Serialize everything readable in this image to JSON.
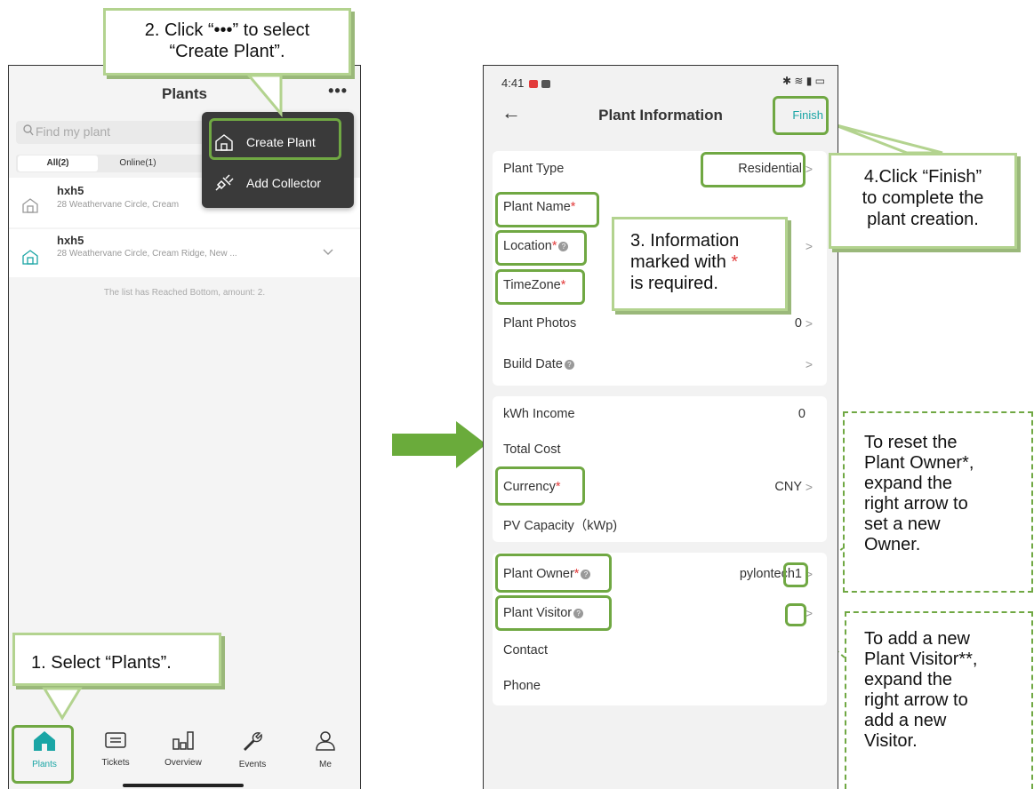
{
  "left_phone": {
    "title": "Plants",
    "more": "•••",
    "search_placeholder": "Find my plant",
    "tabs": [
      "All(2)",
      "Online(1)"
    ],
    "plants": [
      {
        "name": "hxh5",
        "address": "28 Weathervane Circle, Cream"
      },
      {
        "name": "hxh5",
        "address": "28 Weathervane Circle, Cream Ridge, New ..."
      }
    ],
    "list_end": "The list has Reached Bottom, amount: 2.",
    "menu": [
      {
        "label": "Create Plant",
        "icon": "house-icon"
      },
      {
        "label": "Add Collector",
        "icon": "plug-icon"
      }
    ],
    "nav": [
      {
        "label": "Plants",
        "icon": "home-icon"
      },
      {
        "label": "Tickets",
        "icon": "ticket-icon"
      },
      {
        "label": "Overview",
        "icon": "bars-icon"
      },
      {
        "label": "Events",
        "icon": "wrench-icon"
      },
      {
        "label": "Me",
        "icon": "person-icon"
      }
    ]
  },
  "right_phone": {
    "time": "4:41",
    "status_icons": "✱ ≋ ▮ ▭",
    "back": "←",
    "title": "Plant Information",
    "finish": "Finish",
    "fields": {
      "plant_type": {
        "label": "Plant Type",
        "value": "Residential"
      },
      "plant_name": {
        "label": "Plant Name",
        "req": "*"
      },
      "location": {
        "label": "Location",
        "req": "*"
      },
      "timezone": {
        "label": "TimeZone",
        "req": "*"
      },
      "plant_photos": {
        "label": "Plant Photos",
        "value": "0"
      },
      "build_date": {
        "label": "Build Date"
      },
      "kwh_income": {
        "label": "kWh Income",
        "value": "0"
      },
      "total_cost": {
        "label": "Total Cost"
      },
      "currency": {
        "label": "Currency",
        "req": "*",
        "value": "CNY"
      },
      "pv_capacity": {
        "label": "PV Capacity（kWp)"
      },
      "plant_owner": {
        "label": "Plant Owner",
        "req": "*",
        "value": "pylontech1"
      },
      "plant_visitor": {
        "label": "Plant Visitor"
      },
      "contact": {
        "label": "Contact"
      },
      "phone": {
        "label": "Phone"
      }
    }
  },
  "annotations": {
    "step1": "1. Select “Plants”.",
    "step2_line1": "2. Click “•••” to select",
    "step2_line2": "“Create Plant”.",
    "step3_line1": "3. Information",
    "step3_line2": "marked with",
    "step3_star": "*",
    "step3_line3": "is required.",
    "step4_line1": "4.Click “Finish”",
    "step4_line2": "to complete the",
    "step4_line3": "plant creation.",
    "owner_note": [
      "To reset the",
      "Plant Owner*,",
      "expand the",
      "right arrow to",
      "set a new",
      "Owner."
    ],
    "visitor_note": [
      "To add a new",
      "Plant Visitor**,",
      "expand the",
      "right arrow to",
      "add a new",
      "Visitor."
    ]
  },
  "colors": {
    "accent_green": "#70a843",
    "teal": "#1aa5a5",
    "arrow_green": "#6aab3b",
    "required_red": "#e23b3b"
  }
}
